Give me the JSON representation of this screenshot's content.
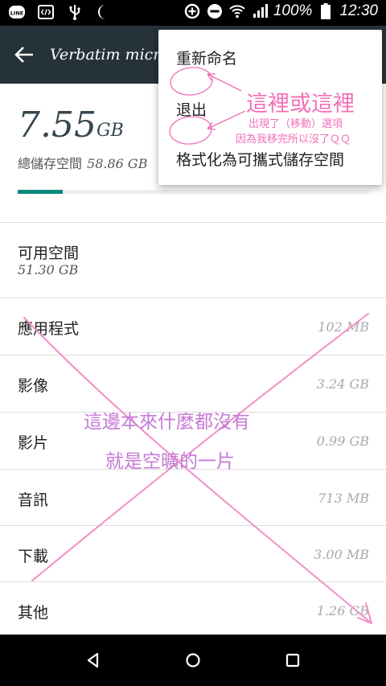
{
  "status_bar": {
    "battery": "100%",
    "time": "12:30",
    "left_icons": [
      "line-icon",
      "code-icon",
      "usb-icon",
      "moon-icon"
    ],
    "right_icons": [
      "data-saver-icon",
      "do-not-disturb-icon",
      "wifi-icon",
      "signal-icon",
      "battery-icon"
    ]
  },
  "app_bar": {
    "title": "Verbatim micro SD"
  },
  "summary": {
    "used_value": "7.55",
    "used_unit": "GB",
    "total_label": "總儲存空間",
    "total_value": "58.86 GB",
    "used_fraction": 0.128
  },
  "free_space": {
    "label": "可用空間",
    "value": "51.30 GB"
  },
  "categories": [
    {
      "label": "應用程式",
      "value": "102 MB"
    },
    {
      "label": "影像",
      "value": "3.24 GB"
    },
    {
      "label": "影片",
      "value": "0.99 GB"
    },
    {
      "label": "音訊",
      "value": "713 MB"
    },
    {
      "label": "下載",
      "value": "3.00 MB"
    },
    {
      "label": "其他",
      "value": "1.26 GB"
    }
  ],
  "overflow_menu": {
    "items": [
      "重新命名",
      "退出",
      "格式化為可攜式儲存空間"
    ]
  },
  "annotations": {
    "menu_note_title": "這裡或這裡",
    "menu_note_line1": "出現了（移動）選項",
    "menu_note_line2": "因為我移完所以沒了ＱＱ",
    "list_note_line1": "這邊本來什麼都沒有",
    "list_note_line2": "就是空曠的一片"
  },
  "colors": {
    "app_bar": "#26323a",
    "accent": "#00897b",
    "annotation_pink": "#f070b8"
  }
}
